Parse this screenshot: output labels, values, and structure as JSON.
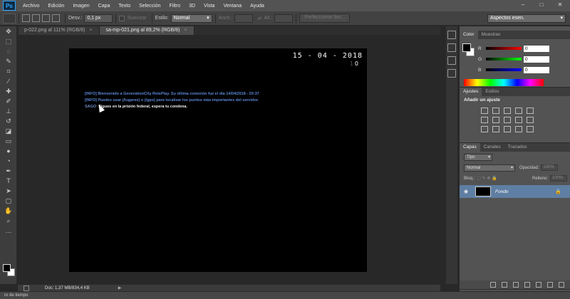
{
  "app": {
    "logo": "Ps",
    "menu": [
      "Archivo",
      "Edición",
      "Imagen",
      "Capa",
      "Texto",
      "Selección",
      "Filtro",
      "3D",
      "Vista",
      "Ventana",
      "Ayuda"
    ],
    "window_controls": [
      "–",
      "□",
      "✕"
    ]
  },
  "options": {
    "feather_label": "Desv.:",
    "feather_value": "0,1 px",
    "antialias_label": "Suavizar",
    "style_label": "Estilo:",
    "style_value": "Normal",
    "width_label": "Anch.:",
    "height_label": "Alt.:",
    "refine_button": "Perfeccionar bor...",
    "workspace": "Aspectos esen."
  },
  "tabs": [
    {
      "label": "p-022.png al 111% (RGB/8)",
      "close": "×"
    },
    {
      "label": "sa-mp-021.png al 89,2% (RGB/8)",
      "close": "×"
    }
  ],
  "image": {
    "date": "15 - 04 - 2018",
    "time_prefix": "1",
    "time_value": "0",
    "chat": {
      "line1": "[INFO] Bienvenido a GenerationCity RolePlay. Su última conexión fue el día 14/04/2018 - 20:37",
      "line2": "[INFO] Puedes usar (/lugares) o (/gps) para localizar los puntos más importantes del servidor.",
      "line3_prefix": "SAGO",
      "line3_text": "Sigues en la prisión federal, espera tu condena."
    }
  },
  "status": {
    "doc_info": "Doc: 1,37 MB/834,4 KB",
    "arrow": "▶",
    "timeline": "ro de tiempo"
  },
  "color_panel": {
    "tabs": [
      "Color",
      "Muestras"
    ],
    "r_label": "R",
    "r_value": "0",
    "g_label": "G",
    "g_value": "0",
    "b_label": "B",
    "b_value": "0"
  },
  "adjust_panel": {
    "tabs": [
      "Ajustes",
      "Estilos"
    ],
    "title": "Añadir un ajuste"
  },
  "layers_panel": {
    "tabs": [
      "Capas",
      "Canales",
      "Trazados"
    ],
    "filter": "Tipo",
    "blend": "Normal",
    "opacity_label": "Opacidad:",
    "opacity_value": "100%",
    "lock_label": "Bloq.:",
    "fill_label": "Relleno:",
    "fill_value": "100%",
    "layer_name": "Fondo"
  },
  "colors": {
    "accent": "#31a8ff",
    "selected_layer": "#5f7ea3",
    "chat_blue": "#5a86d4"
  }
}
